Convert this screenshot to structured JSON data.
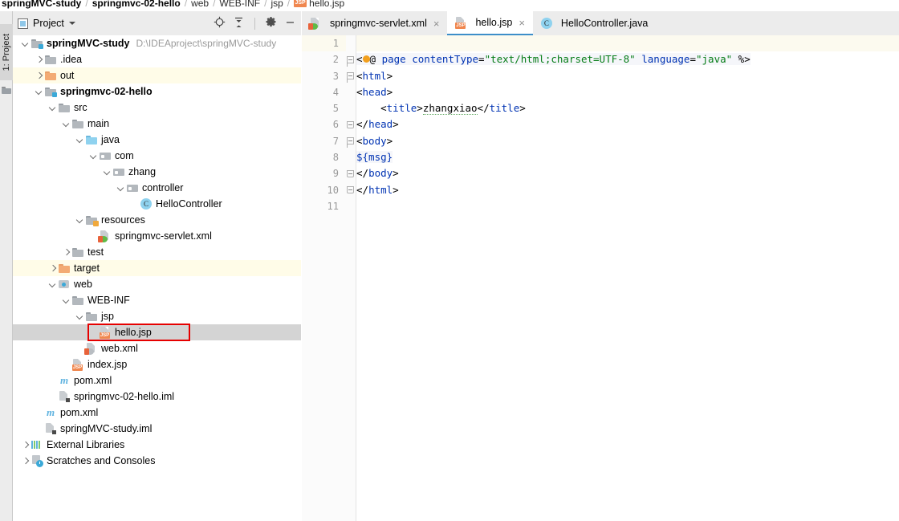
{
  "breadcrumb": {
    "items": [
      {
        "label": "springMVC-study",
        "bold": true,
        "icon": null
      },
      {
        "label": "springmvc-02-hello",
        "bold": true,
        "icon": null
      },
      {
        "label": "web",
        "bold": false,
        "icon": null
      },
      {
        "label": "WEB-INF",
        "bold": false,
        "icon": null
      },
      {
        "label": "jsp",
        "bold": false,
        "icon": null
      },
      {
        "label": "hello.jsp",
        "bold": false,
        "icon": "jsp-file-icon"
      }
    ],
    "separator": "/"
  },
  "left_rail": {
    "tab_label": "1: Project",
    "icon_name": "folder-icon"
  },
  "project_panel": {
    "title": "Project",
    "window_icon": "project-window-icon",
    "dropdown_icon": "chevron-down-icon",
    "buttons": [
      {
        "name": "locate-in-tree-icon",
        "tooltip": "Select Opened File"
      },
      {
        "name": "collapse-all-icon",
        "tooltip": "Collapse All"
      },
      {
        "name": "gear-icon",
        "tooltip": "Settings"
      },
      {
        "name": "minimize-icon",
        "tooltip": "Hide"
      }
    ]
  },
  "tree": {
    "rows": [
      {
        "indent": 0,
        "arrow": "open",
        "icon": "module-folder-icon",
        "label": "springMVC-study",
        "bold": true,
        "hint": "D:\\IDEAproject\\springMVC-study",
        "state": "normal"
      },
      {
        "indent": 1,
        "arrow": "closed",
        "icon": "folder-icon",
        "label": ".idea",
        "bold": false,
        "hint": "",
        "state": "normal"
      },
      {
        "indent": 1,
        "arrow": "closed",
        "icon": "folder-orange-icon",
        "label": "out",
        "bold": false,
        "hint": "",
        "state": "excluded"
      },
      {
        "indent": 1,
        "arrow": "open",
        "icon": "module-folder-icon",
        "label": "springmvc-02-hello",
        "bold": true,
        "hint": "",
        "state": "normal"
      },
      {
        "indent": 2,
        "arrow": "open",
        "icon": "folder-icon",
        "label": "src",
        "bold": false,
        "hint": "",
        "state": "normal"
      },
      {
        "indent": 3,
        "arrow": "open",
        "icon": "folder-icon",
        "label": "main",
        "bold": false,
        "hint": "",
        "state": "normal"
      },
      {
        "indent": 4,
        "arrow": "open",
        "icon": "source-folder-icon",
        "label": "java",
        "bold": false,
        "hint": "",
        "state": "normal"
      },
      {
        "indent": 5,
        "arrow": "open",
        "icon": "package-icon",
        "label": "com",
        "bold": false,
        "hint": "",
        "state": "normal"
      },
      {
        "indent": 6,
        "arrow": "open",
        "icon": "package-icon",
        "label": "zhang",
        "bold": false,
        "hint": "",
        "state": "normal"
      },
      {
        "indent": 7,
        "arrow": "open",
        "icon": "package-icon",
        "label": "controller",
        "bold": false,
        "hint": "",
        "state": "normal"
      },
      {
        "indent": 8,
        "arrow": "none",
        "icon": "java-class-icon",
        "label": "HelloController",
        "bold": false,
        "hint": "",
        "state": "normal"
      },
      {
        "indent": 4,
        "arrow": "open",
        "icon": "resources-folder-icon",
        "label": "resources",
        "bold": false,
        "hint": "",
        "state": "normal"
      },
      {
        "indent": 5,
        "arrow": "none",
        "icon": "spring-xml-icon",
        "label": "springmvc-servlet.xml",
        "bold": false,
        "hint": "",
        "state": "normal"
      },
      {
        "indent": 3,
        "arrow": "closed",
        "icon": "folder-icon",
        "label": "test",
        "bold": false,
        "hint": "",
        "state": "normal"
      },
      {
        "indent": 2,
        "arrow": "closed",
        "icon": "folder-orange-icon",
        "label": "target",
        "bold": false,
        "hint": "",
        "state": "excluded"
      },
      {
        "indent": 2,
        "arrow": "open",
        "icon": "web-folder-icon",
        "label": "web",
        "bold": false,
        "hint": "",
        "state": "normal"
      },
      {
        "indent": 3,
        "arrow": "open",
        "icon": "folder-icon",
        "label": "WEB-INF",
        "bold": false,
        "hint": "",
        "state": "normal"
      },
      {
        "indent": 4,
        "arrow": "open",
        "icon": "folder-icon",
        "label": "jsp",
        "bold": false,
        "hint": "",
        "state": "normal"
      },
      {
        "indent": 5,
        "arrow": "none",
        "icon": "jsp-file-icon",
        "label": "hello.jsp",
        "bold": false,
        "hint": "",
        "state": "selected"
      },
      {
        "indent": 4,
        "arrow": "none",
        "icon": "web-xml-icon",
        "label": "web.xml",
        "bold": false,
        "hint": "",
        "state": "normal"
      },
      {
        "indent": 3,
        "arrow": "none",
        "icon": "jsp-file-icon",
        "label": "index.jsp",
        "bold": false,
        "hint": "",
        "state": "normal"
      },
      {
        "indent": 2,
        "arrow": "none",
        "icon": "maven-icon",
        "label": "pom.xml",
        "bold": false,
        "hint": "",
        "state": "normal"
      },
      {
        "indent": 2,
        "arrow": "none",
        "icon": "iml-icon",
        "label": "springmvc-02-hello.iml",
        "bold": false,
        "hint": "",
        "state": "normal"
      },
      {
        "indent": 1,
        "arrow": "none",
        "icon": "maven-icon",
        "label": "pom.xml",
        "bold": false,
        "hint": "",
        "state": "normal"
      },
      {
        "indent": 1,
        "arrow": "none",
        "icon": "iml-icon",
        "label": "springMVC-study.iml",
        "bold": false,
        "hint": "",
        "state": "normal"
      },
      {
        "indent": 0,
        "arrow": "closed",
        "icon": "external-libraries-icon",
        "label": "External Libraries",
        "bold": false,
        "hint": "",
        "state": "normal"
      },
      {
        "indent": 0,
        "arrow": "closed",
        "icon": "scratches-icon",
        "label": "Scratches and Consoles",
        "bold": false,
        "hint": "",
        "state": "normal"
      }
    ],
    "annotation": {
      "target_label": "hello.jsp",
      "color": "#e60000"
    }
  },
  "editor": {
    "tabs": [
      {
        "label": "springmvc-servlet.xml",
        "icon": "spring-xml-icon",
        "active": false,
        "close_glyph": "×"
      },
      {
        "label": "hello.jsp",
        "icon": "jsp-file-icon",
        "active": true,
        "close_glyph": "×"
      },
      {
        "label": "HelloController.java",
        "icon": "java-class-icon",
        "active": false,
        "close_glyph": ""
      }
    ],
    "line_numbers": [
      "1",
      "2",
      "3",
      "4",
      "5",
      "6",
      "7",
      "8",
      "9",
      "10",
      "11"
    ],
    "current_line": 1,
    "code_lines": [
      {
        "n": 1,
        "text": ""
      },
      {
        "n": 2,
        "text": "<%@ page contentType=\"text/html;charset=UTF-8\" language=\"java\" %>"
      },
      {
        "n": 3,
        "text": "<html>"
      },
      {
        "n": 4,
        "text": "<head>"
      },
      {
        "n": 5,
        "text": "    <title>zhangxiao</title>"
      },
      {
        "n": 6,
        "text": "</head>"
      },
      {
        "n": 7,
        "text": "<body>"
      },
      {
        "n": 8,
        "text": "${msg}"
      },
      {
        "n": 9,
        "text": "</body>"
      },
      {
        "n": 10,
        "text": "</html>"
      },
      {
        "n": 11,
        "text": ""
      }
    ],
    "tokens": {
      "directive_open": "<%@",
      "directive_keyword": "page",
      "attr_contentType": "contentType",
      "val_contentType": "\"text/html;charset=UTF-8\"",
      "attr_language": "language",
      "val_language": "\"java\"",
      "directive_close": "%>",
      "tag_html_open": "html",
      "tag_head_open": "head",
      "tag_title_open": "title",
      "title_text": "zhangxiao",
      "tag_title_close": "title",
      "tag_head_close": "head",
      "tag_body_open": "body",
      "el_msg": "${msg}",
      "tag_body_close": "body",
      "tag_html_close": "html"
    },
    "colors": {
      "tag": "#0033b3",
      "string": "#067d17",
      "text": "#000000",
      "line_number": "#999999",
      "current_line_bg": "#fcfaef",
      "active_tab_underline": "#3d8ec9"
    }
  }
}
